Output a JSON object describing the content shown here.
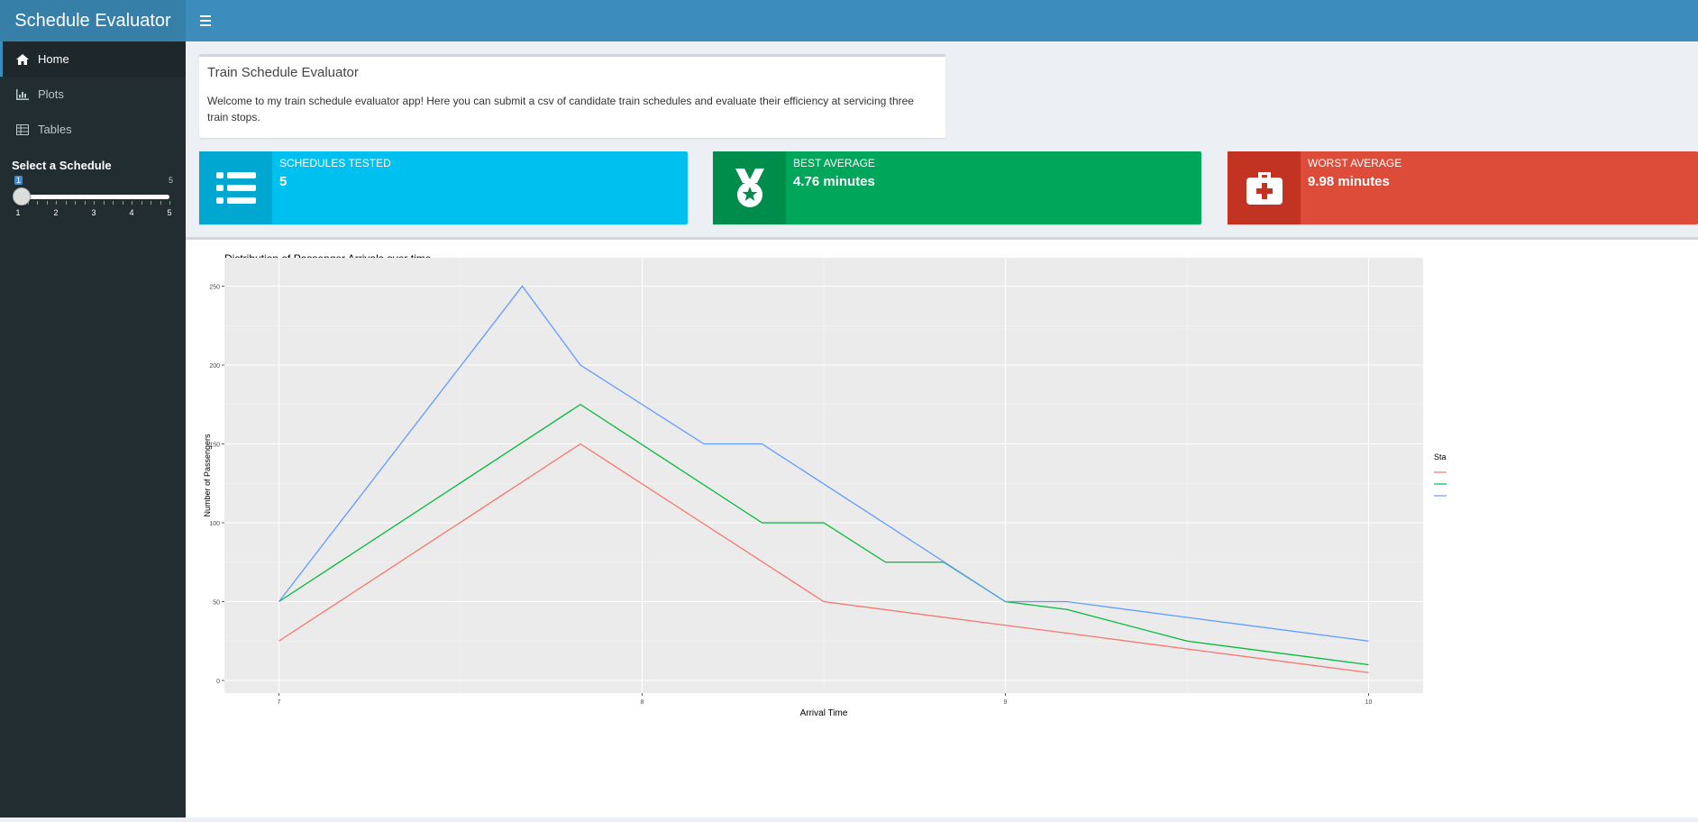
{
  "app": {
    "title": "Schedule Evaluator"
  },
  "header": {
    "toggle_icon": "hamburger-icon"
  },
  "sidebar": {
    "items": [
      {
        "label": "Home",
        "icon": "home-icon",
        "active": true
      },
      {
        "label": "Plots",
        "icon": "bar-chart-icon",
        "active": false
      },
      {
        "label": "Tables",
        "icon": "table-icon",
        "active": false
      }
    ],
    "slider": {
      "label": "Select a Schedule",
      "min": "1",
      "max": "5",
      "value": 1,
      "tick_labels": [
        "1",
        "2",
        "3",
        "4",
        "5"
      ]
    }
  },
  "intro": {
    "title": "Train Schedule Evaluator",
    "text": "Welcome to my train schedule evaluator app! Here you can submit a csv of candidate train schedules and evaluate their efficiency at servicing three train stops."
  },
  "info_boxes": [
    {
      "title": "SCHEDULES TESTED",
      "value": "5",
      "icon": "list-icon",
      "color": "#00c0ef",
      "icon_bg": "#00a7d0"
    },
    {
      "title": "BEST AVERAGE",
      "value": "4.76 minutes",
      "icon": "medal-icon",
      "color": "#00a65a",
      "icon_bg": "#008d4c"
    },
    {
      "title": "WORST AVERAGE",
      "value": "9.98 minutes",
      "icon": "medkit-icon",
      "color": "#dd4b39",
      "icon_bg": "#c23321"
    }
  ],
  "chart_data": {
    "type": "line",
    "title": "Distribution of Passenger Arrivals over time",
    "xlabel": "Arrival Time",
    "ylabel": "Number of Passengers",
    "xlim": [
      6.85,
      10.15
    ],
    "ylim": [
      -8,
      268
    ],
    "xticks": [
      7,
      8,
      9,
      10
    ],
    "yticks": [
      0,
      50,
      100,
      150,
      200,
      250
    ],
    "grid": true,
    "legend_title": "Sta",
    "legend_position": "right",
    "series": [
      {
        "color": "#F8766D",
        "x": [
          7,
          7.83,
          8.5,
          9,
          9.17,
          9.5,
          10
        ],
        "y": [
          25,
          150,
          50,
          35,
          30,
          20,
          5
        ]
      },
      {
        "color": "#00BA38",
        "x": [
          7,
          7.83,
          8.33,
          8.5,
          8.67,
          8.83,
          9,
          9.17,
          9.5,
          10
        ],
        "y": [
          50,
          175,
          100,
          100,
          75,
          75,
          50,
          45,
          25,
          10
        ]
      },
      {
        "color": "#619CFF",
        "x": [
          7,
          7.67,
          7.83,
          8.17,
          8.33,
          9,
          9.17,
          9.5,
          10
        ],
        "y": [
          50,
          250,
          200,
          150,
          150,
          50,
          50,
          40,
          25
        ]
      }
    ]
  }
}
